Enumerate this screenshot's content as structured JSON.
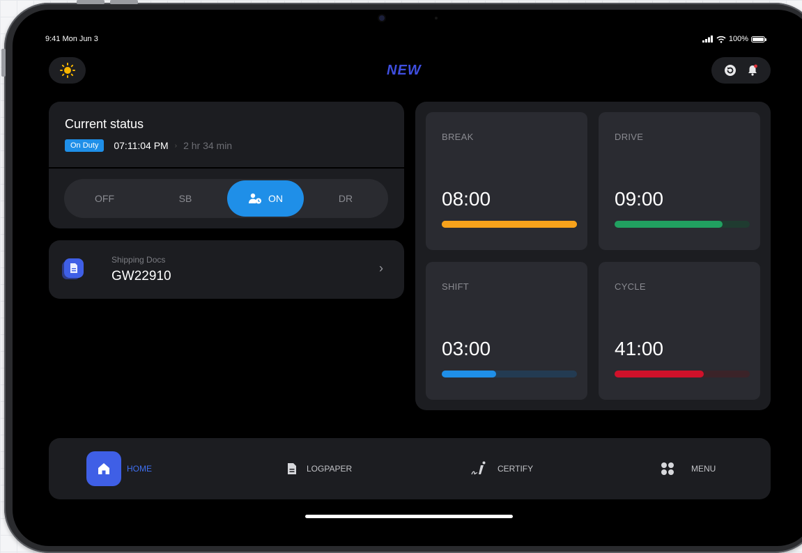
{
  "status_bar": {
    "time": "9:41 Mon Jun 3",
    "battery": "100%"
  },
  "header": {
    "logo_text": "NEW"
  },
  "current_status": {
    "title": "Current status",
    "badge": "On Duty",
    "time": "07:11:04 PM",
    "separator": "›",
    "duration": "2 hr 34 min"
  },
  "duty_toggle": {
    "options": [
      "OFF",
      "SB",
      "ON",
      "DR"
    ],
    "selected": "ON"
  },
  "shipping_docs": {
    "label": "Shipping Docs",
    "value": "GW22910",
    "chevron": "›"
  },
  "timers": [
    {
      "label": "BREAK",
      "value": "08:00",
      "progress": 1.0,
      "color": "#f7a21b",
      "track": "#f7a21b"
    },
    {
      "label": "DRIVE",
      "value": "09:00",
      "progress": 0.8,
      "color": "#21a060",
      "track": "#1f3b30"
    },
    {
      "label": "SHIFT",
      "value": "03:00",
      "progress": 0.4,
      "color": "#1f8fe8",
      "track": "#233b52"
    },
    {
      "label": "CYCLE",
      "value": "41:00",
      "progress": 0.66,
      "color": "#d0112a",
      "track": "#3b2328"
    }
  ],
  "bottom_nav": {
    "items": [
      {
        "label": "HOME",
        "icon": "home-icon",
        "active": true
      },
      {
        "label": "LOGPAPER",
        "icon": "document-icon",
        "active": false
      },
      {
        "label": "CERTIFY",
        "icon": "signature-icon",
        "active": false
      },
      {
        "label": "MENU",
        "icon": "grid-icon",
        "active": false
      }
    ]
  },
  "colors": {
    "accent": "#1f8fe8",
    "brand": "#3f5fe6",
    "sun": "#f7b500",
    "notification_dot": "#e0323a"
  }
}
